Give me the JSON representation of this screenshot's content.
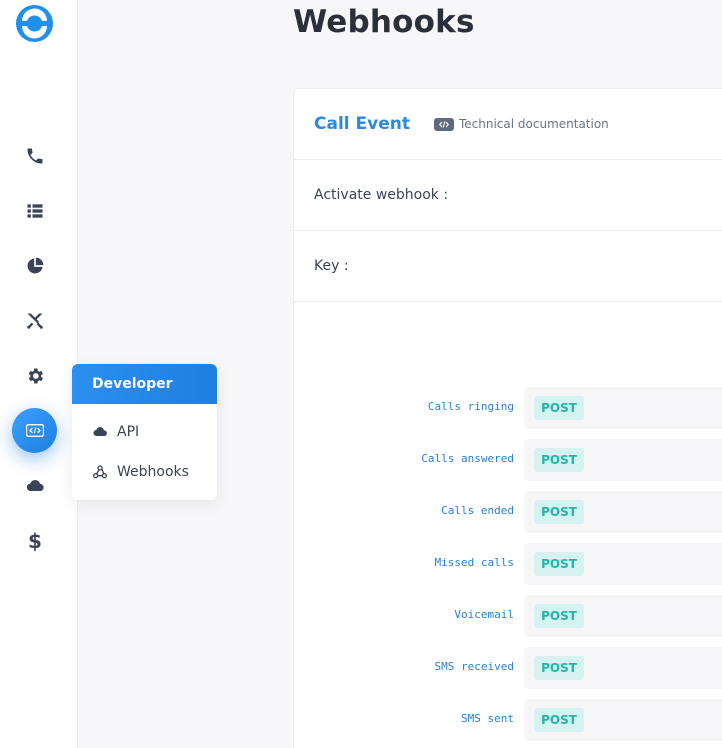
{
  "header": {
    "title": "Webhooks"
  },
  "sidebar": {
    "icons": [
      "phone-icon",
      "list-icon",
      "pie-chart-icon",
      "swords-icon",
      "gear-icon",
      "code-icon",
      "cloud-icon",
      "dollar-icon"
    ],
    "dollar_glyph": "$",
    "active_color": "#1f7fe0"
  },
  "flyout": {
    "header": "Developer",
    "items": [
      {
        "label": "API",
        "icon": "cloud-icon"
      },
      {
        "label": "Webhooks",
        "icon": "webhook-icon"
      }
    ]
  },
  "card": {
    "title": "Call Event",
    "doc_link": "Technical documentation",
    "rows": [
      {
        "label": "Activate webhook :"
      },
      {
        "label": "Key :"
      }
    ],
    "events": [
      {
        "label": "Calls ringing",
        "method": "POST"
      },
      {
        "label": "Calls answered",
        "method": "POST"
      },
      {
        "label": "Calls ended",
        "method": "POST"
      },
      {
        "label": "Missed calls",
        "method": "POST"
      },
      {
        "label": "Voicemail",
        "method": "POST"
      },
      {
        "label": "SMS received",
        "method": "POST"
      },
      {
        "label": "SMS sent",
        "method": "POST"
      }
    ]
  },
  "colors": {
    "accent": "#2a8ae0",
    "post_badge_bg": "#d6f3f1",
    "post_badge_text": "#1fb5a9"
  }
}
